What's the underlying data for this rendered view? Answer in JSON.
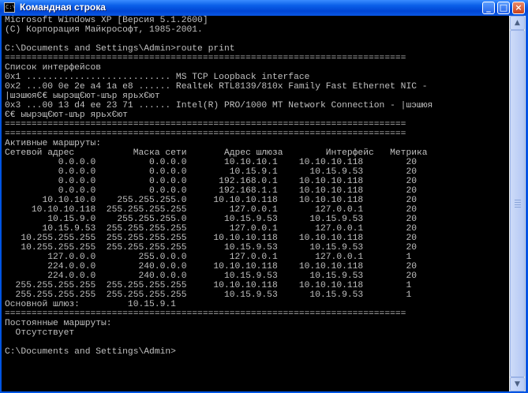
{
  "window": {
    "title": "Командная строка",
    "icon": "cmd-icon",
    "icon_text": "C:\\",
    "buttons": {
      "minimize": "_",
      "maximize": "□",
      "close": "×"
    }
  },
  "console": {
    "lines": [
      "Microsoft Windows XP [Версия 5.1.2600]",
      "(С) Корпорация Майкрософт, 1985-2001.",
      "",
      "C:\\Documents and Settings\\Admin>route print",
      "===========================================================================",
      "Список интерфейсов",
      "0x1 ........................... MS TCP Loopback interface",
      "0x2 ...00 0e 2e a4 1a e8 ...... Realtek RTL8139/810x Family Fast Ethernet NIC -",
      "|шэшюяЄ€ ыырэщЄют-шър ярьхЄют",
      "0x3 ...00 13 d4 ee 23 71 ...... Intel(R) PRO/1000 MT Network Connection - |шэшюя",
      "Є€ ыырэщЄют-шър ярьхЄют",
      "===========================================================================",
      "===========================================================================",
      "Активные маршруты:",
      "Сетевой адрес           Маска сети       Адрес шлюза        Интерфейс   Метрика",
      "          0.0.0.0          0.0.0.0       10.10.10.1    10.10.10.118        20",
      "          0.0.0.0          0.0.0.0        10.15.9.1      10.15.9.53        20",
      "          0.0.0.0          0.0.0.0      192.168.0.1    10.10.10.118        20",
      "          0.0.0.0          0.0.0.0      192.168.1.1    10.10.10.118        20",
      "       10.10.10.0    255.255.255.0     10.10.10.118    10.10.10.118        20",
      "     10.10.10.118  255.255.255.255        127.0.0.1       127.0.0.1        20",
      "        10.15.9.0    255.255.255.0       10.15.9.53      10.15.9.53        20",
      "       10.15.9.53  255.255.255.255        127.0.0.1       127.0.0.1        20",
      "   10.255.255.255  255.255.255.255     10.10.10.118    10.10.10.118        20",
      "   10.255.255.255  255.255.255.255       10.15.9.53      10.15.9.53        20",
      "        127.0.0.0        255.0.0.0        127.0.0.1       127.0.0.1        1",
      "        224.0.0.0        240.0.0.0     10.10.10.118    10.10.10.118        20",
      "        224.0.0.0        240.0.0.0       10.15.9.53      10.15.9.53        20",
      "  255.255.255.255  255.255.255.255     10.10.10.118    10.10.10.118        1",
      "  255.255.255.255  255.255.255.255       10.15.9.53      10.15.9.53        1",
      "Основной шлюз:         10.15.9.1",
      "===========================================================================",
      "Постоянные маршруты:",
      "  Отсутствует",
      "",
      "C:\\Documents and Settings\\Admin>"
    ]
  },
  "scrollbar": {
    "up_arrow": "▲",
    "down_arrow": "▼"
  }
}
